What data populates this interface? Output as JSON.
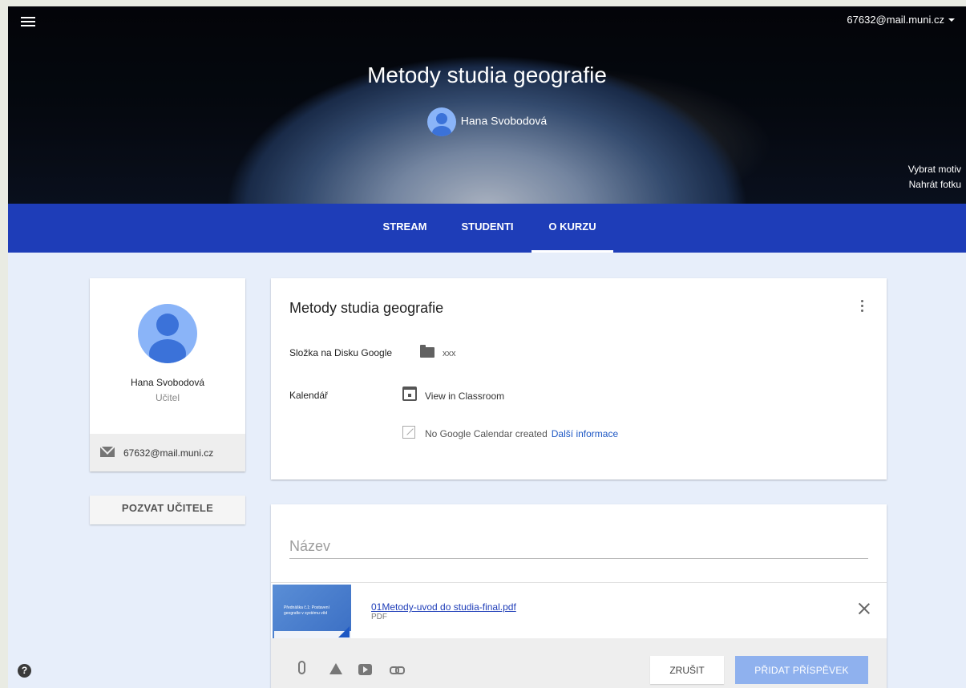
{
  "header": {
    "account_email": "67632@mail.muni.cz",
    "course_title": "Metody studia geografie",
    "teacher_name": "Hana Svobodová",
    "choose_theme": "Vybrat motiv",
    "upload_photo": "Nahrát fotku"
  },
  "tabs": [
    {
      "label": "STREAM"
    },
    {
      "label": "STUDENTI"
    },
    {
      "label": "O KURZU",
      "active": true
    }
  ],
  "teacher_card": {
    "name": "Hana Svobodová",
    "role": "Učitel",
    "email": "67632@mail.muni.cz",
    "invite_label": "POZVAT UČITELE"
  },
  "about": {
    "title": "Metody studia geografie",
    "drive_label": "Složka na Disku Google",
    "drive_folder": "xxx",
    "calendar_label": "Kalendář",
    "calendar_link": "View in Classroom",
    "no_calendar": "No Google Calendar created",
    "more_info": "Další informace"
  },
  "post": {
    "name_placeholder": "Název",
    "attachment": {
      "file_name": "01Metody-uvod do studia-final.pdf",
      "file_type": "PDF",
      "thumb_line1": "Přednáška č.1: Postavení",
      "thumb_line2": "geografie v systému věd"
    },
    "cancel_label": "ZRUŠIT",
    "submit_label": "PŘIDAT PŘÍSPĚVEK"
  },
  "help_label": "?",
  "colors": {
    "tab_bar": "#1e3db8",
    "link": "#1e58c4",
    "submit_button": "#8fb1ee",
    "page_background": "#e7eefa"
  },
  "icons": [
    "menu-icon",
    "dropdown-caret-icon",
    "email-icon",
    "more-vert-icon",
    "folder-icon",
    "calendar-icon",
    "external-link-icon",
    "close-icon",
    "attach-icon",
    "drive-icon",
    "youtube-icon",
    "link-icon",
    "help-icon"
  ]
}
